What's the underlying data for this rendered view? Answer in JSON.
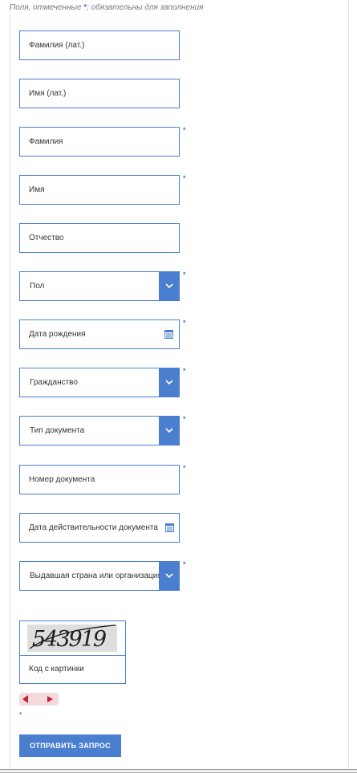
{
  "note": {
    "before": "Поля, отмеченные ",
    "star": "*",
    "after": "; обязательны для заполнения"
  },
  "fields": {
    "last_name_lat": "Фамилия (лат.)",
    "first_name_lat": "Имя (лат.)",
    "last_name": "Фамилия",
    "first_name": "Имя",
    "patronymic": "Отчество",
    "gender": "Пол",
    "birth_date": "Дата рождения",
    "citizenship": "Гражданство",
    "doc_type": "Тип документа",
    "doc_number": "Номер документа",
    "doc_valid_date": "Дата действительности документа",
    "issuing_country": "Выдавшая страна или организация"
  },
  "required_mark": "*",
  "captcha": {
    "code": "543919",
    "label": "Код с картинки"
  },
  "submit_label": "ОТПРАВИТЬ ЗАПРОС",
  "colors": {
    "accent": "#4a7fd0",
    "audio_bg": "#f4dadc",
    "audio_icon": "#c4202f"
  },
  "icons": {
    "dropdown": "chevron-down-icon",
    "calendar": "calendar-icon",
    "audio_prev": "audio-prev-icon",
    "audio_play": "audio-play-icon"
  }
}
